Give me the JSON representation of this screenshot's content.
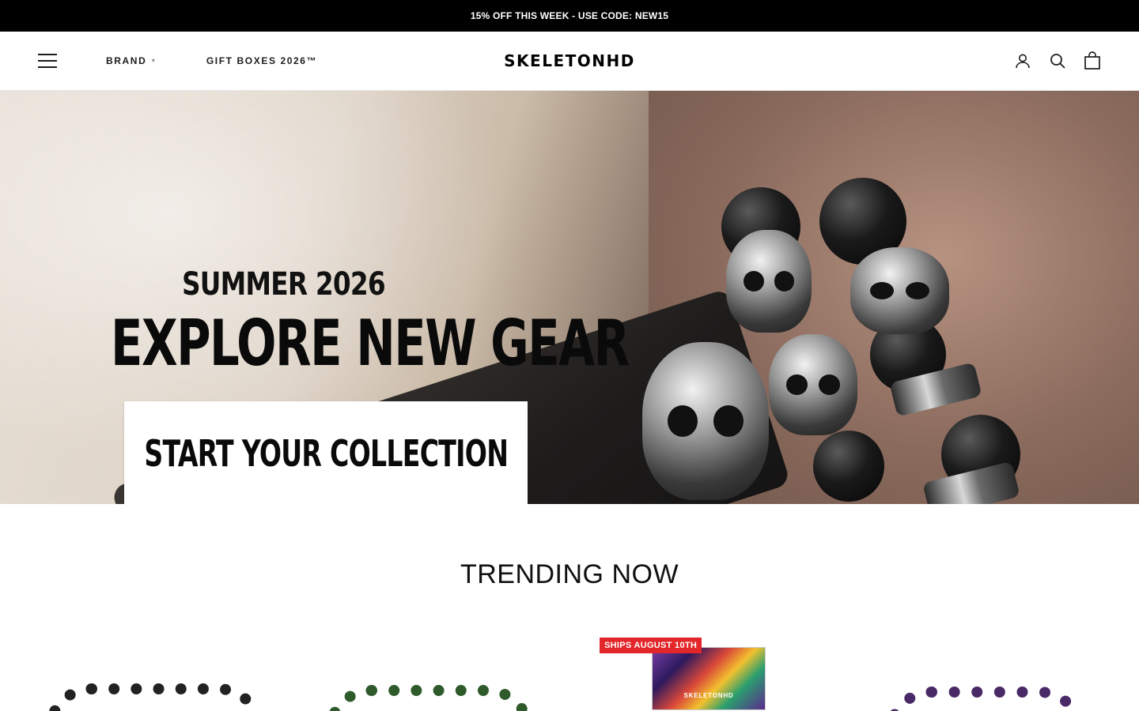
{
  "announcement": {
    "text": "15% OFF THIS WEEK - USE CODE: NEW15"
  },
  "header": {
    "logo": "SKELETONHD",
    "nav": [
      {
        "label": "BRAND",
        "has_dropdown": true
      },
      {
        "label": "GIFT BOXES 2026™",
        "has_dropdown": false
      }
    ],
    "icons": [
      "menu-icon",
      "account-icon",
      "search-icon",
      "cart-icon"
    ]
  },
  "hero": {
    "subtitle": "SUMMER 2026",
    "title": "EXPLORE NEW GEAR",
    "cta_label": "START YOUR COLLECTION"
  },
  "trending": {
    "title": "TRENDING NOW",
    "products": [
      {
        "image": "black-bead-bracelet"
      },
      {
        "image": "green-bead-bracelet"
      },
      {
        "image": "gift-box",
        "badge": "SHIPS AUGUST 10TH",
        "box_label": "SKELETONHD"
      },
      {
        "image": "purple-bead-bracelet"
      }
    ]
  },
  "colors": {
    "announcement_bg": "#000000",
    "badge": "#e3262a",
    "text": "#1c1c1c"
  }
}
